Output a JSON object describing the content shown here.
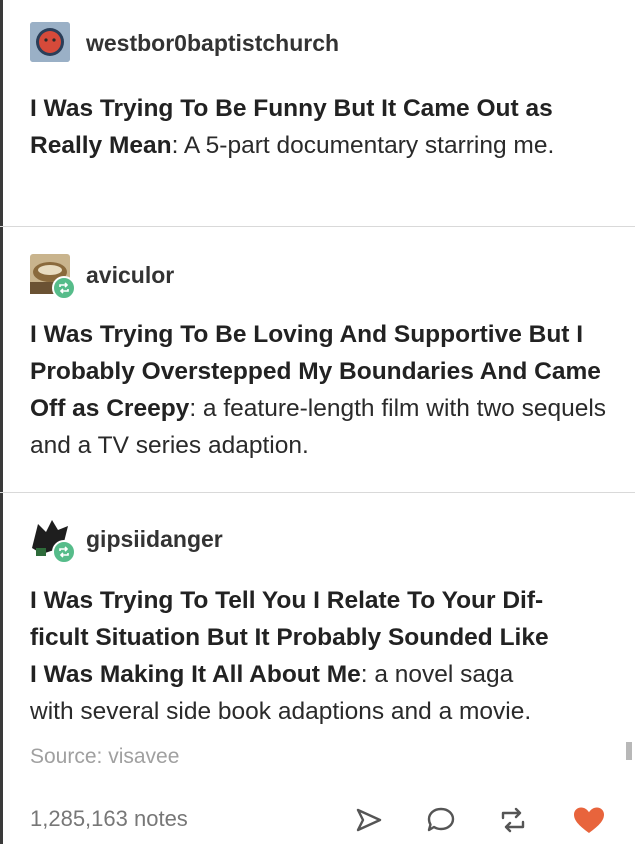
{
  "posts": [
    {
      "username": "westbor0baptistchurch",
      "bold": "I Was Trying To Be Funny But It Came Out as Really Mean",
      "rest": ": A 5-part documentary starring me."
    },
    {
      "username": "aviculor",
      "bold": "I Was Trying To Be Loving And Supportive But I Probably Overstepped My Boundaries And Came Off as Creepy",
      "rest": ": a feature-length film with two sequels and a TV series adaption."
    },
    {
      "username": "gipsiidanger",
      "bold_lines": [
        "I Was Trying To Tell You I Relate To Your Dif-",
        "ficult Situation But It Probably Sounded Like",
        "I Was Making It All About Me"
      ],
      "rest_first": ": a novel saga",
      "rest_second": "with several side book adaptions and a movie."
    }
  ],
  "footer": {
    "source": "Source: visavee",
    "notes": "1,285,163 notes"
  },
  "icons": {
    "share": "share-icon",
    "reply": "reply-icon",
    "reblog": "reblog-icon",
    "like": "heart-icon"
  },
  "colors": {
    "heart": "#e8643c",
    "reblog_badge": "#56bc8a"
  }
}
